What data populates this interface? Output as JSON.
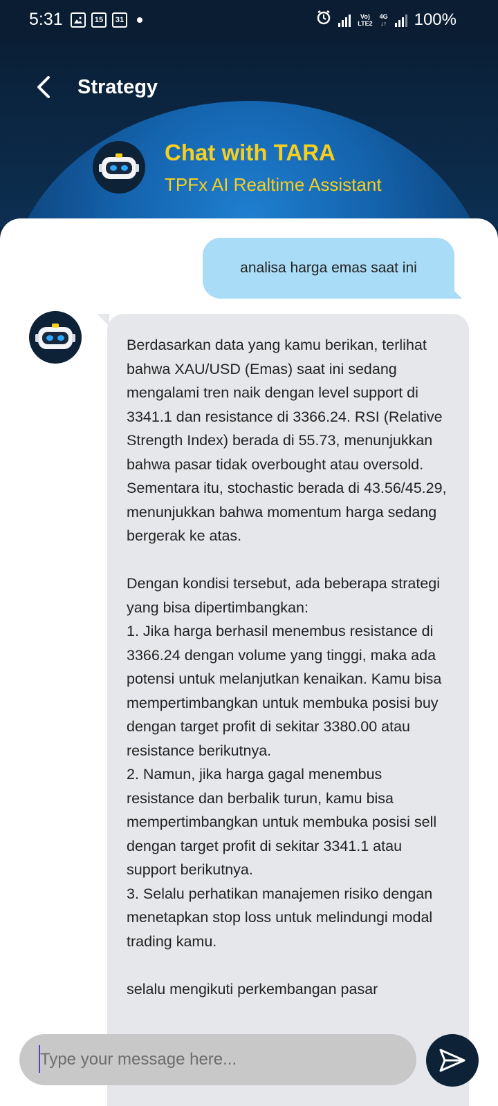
{
  "status_bar": {
    "time": "5:31",
    "left_icons": [
      "image-icon",
      "calendar-15-icon",
      "calendar-31-icon",
      "dot-icon"
    ],
    "calendar_a": "15",
    "calendar_b": "31",
    "volte": "Vo)",
    "lte": "LTE2",
    "net": "4G",
    "battery": "100%"
  },
  "header": {
    "title": "Strategy",
    "chat_title": "Chat with TARA",
    "chat_subtitle": "TPFx AI Realtime Assistant"
  },
  "colors": {
    "header_bg": "#0a1f36",
    "accent_yellow": "#f7cf1e",
    "user_bubble": "#a9dcf6",
    "bot_bubble": "#e6e7ea",
    "dark_avatar": "#0d2237"
  },
  "messages": [
    {
      "sender": "user",
      "text": "analisa harga emas saat ini"
    },
    {
      "sender": "bot",
      "text": "Berdasarkan data yang kamu berikan, terlihat bahwa XAU/USD (Emas) saat ini sedang mengalami tren naik dengan level support di 3341.1 dan resistance di 3366.24. RSI (Relative Strength Index) berada di 55.73, menunjukkan bahwa pasar tidak overbought atau oversold. Sementara itu, stochastic berada di 43.56/45.29, menunjukkan bahwa momentum harga sedang bergerak ke atas.\n\nDengan kondisi tersebut, ada beberapa strategi yang bisa dipertimbangkan:\n1. Jika harga berhasil menembus resistance di 3366.24 dengan volume yang tinggi, maka ada potensi untuk melanjutkan kenaikan. Kamu bisa mempertimbangkan untuk membuka posisi buy dengan target profit di sekitar 3380.00 atau resistance berikutnya.\n2. Namun, jika harga gagal menembus resistance dan berbalik turun, kamu bisa mempertimbangkan untuk membuka posisi sell dengan target profit di sekitar 3341.1 atau support berikutnya.\n3. Selalu perhatikan manajemen risiko dengan menetapkan stop loss untuk melindungi modal trading kamu.\n\nselalu mengikuti perkembangan pasar"
    }
  ],
  "input": {
    "placeholder": "Type your message here..."
  }
}
